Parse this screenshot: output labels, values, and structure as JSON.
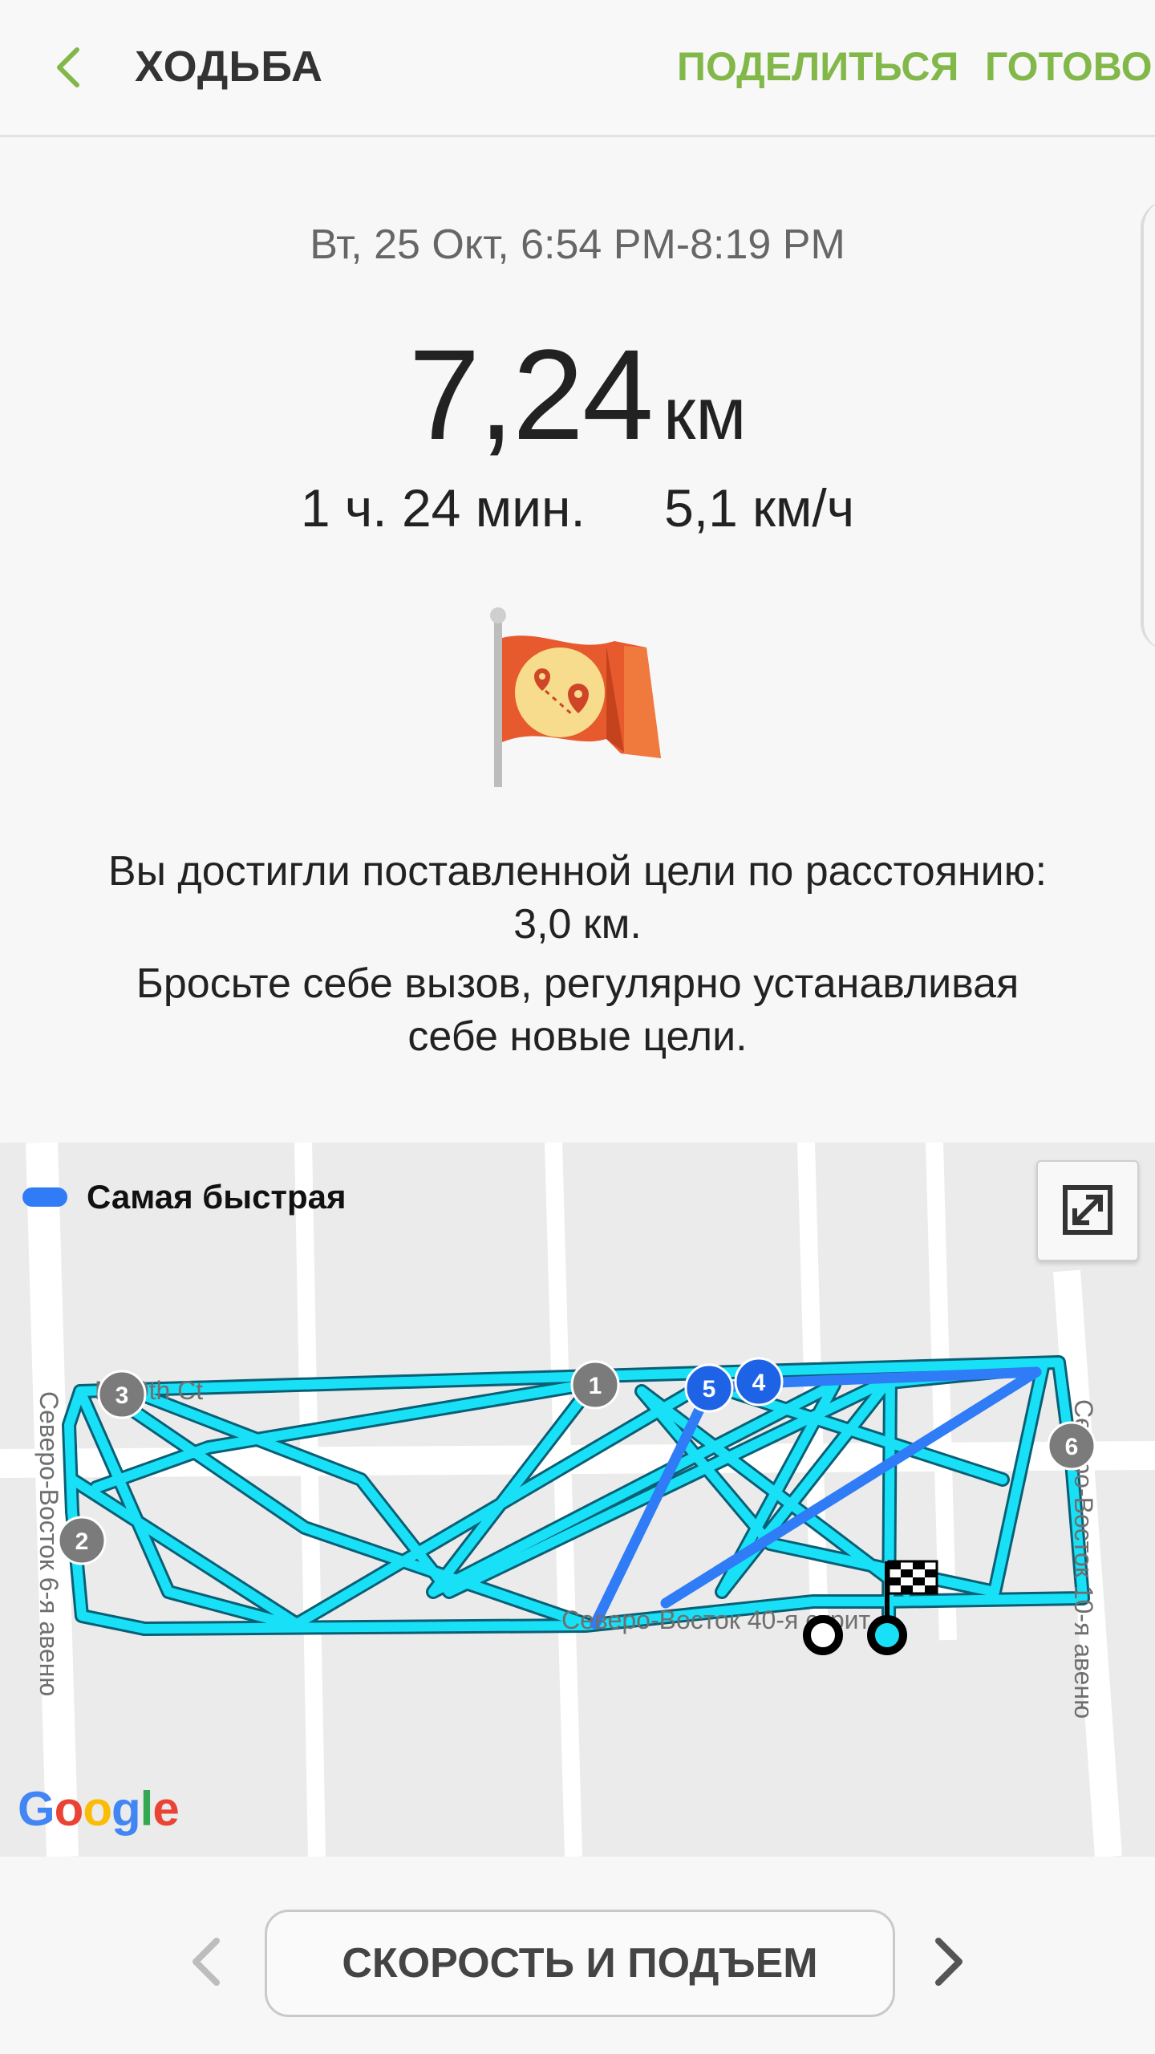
{
  "header": {
    "title": "ХОДЬБА",
    "share_label": "ПОДЕЛИТЬСЯ",
    "done_label": "ГОТОВО"
  },
  "summary": {
    "date_time": "Вт, 25 Окт, 6:54 PM-8:19 PM",
    "distance_value": "7,24",
    "distance_unit": "км",
    "duration": "1 ч. 24 мин.",
    "speed": "5,1 км/ч"
  },
  "goal": {
    "achieved_line1": "Вы достигли поставленной цели по расстоянию:",
    "achieved_line2": "3,0 км.",
    "challenge_line1": "Бросьте себе вызов, регулярно устанавливая",
    "challenge_line2": "себе новые цели."
  },
  "map": {
    "legend_label": "Самая быстрая",
    "street_labels": [
      "N 40th Ct",
      "Северо-Восток 6-я авеню",
      "Северо-Восток 40-я стрит",
      "Северо-Восток 10-я авеню"
    ],
    "markers": [
      "1",
      "2",
      "3",
      "4",
      "5",
      "6"
    ],
    "google_logo": "Google",
    "colors": {
      "route": "#18e1f7",
      "fastest": "#2f7cf6",
      "marker": "#7b7b7b",
      "accent": "#82b84a"
    }
  },
  "bottom": {
    "metric_button_label": "СКОРОСТЬ И ПОДЪЕМ"
  },
  "icons": [
    "back-arrow-icon",
    "goal-flag-icon",
    "expand-icon",
    "chevron-left-icon",
    "chevron-right-icon",
    "finish-flag-icon"
  ]
}
